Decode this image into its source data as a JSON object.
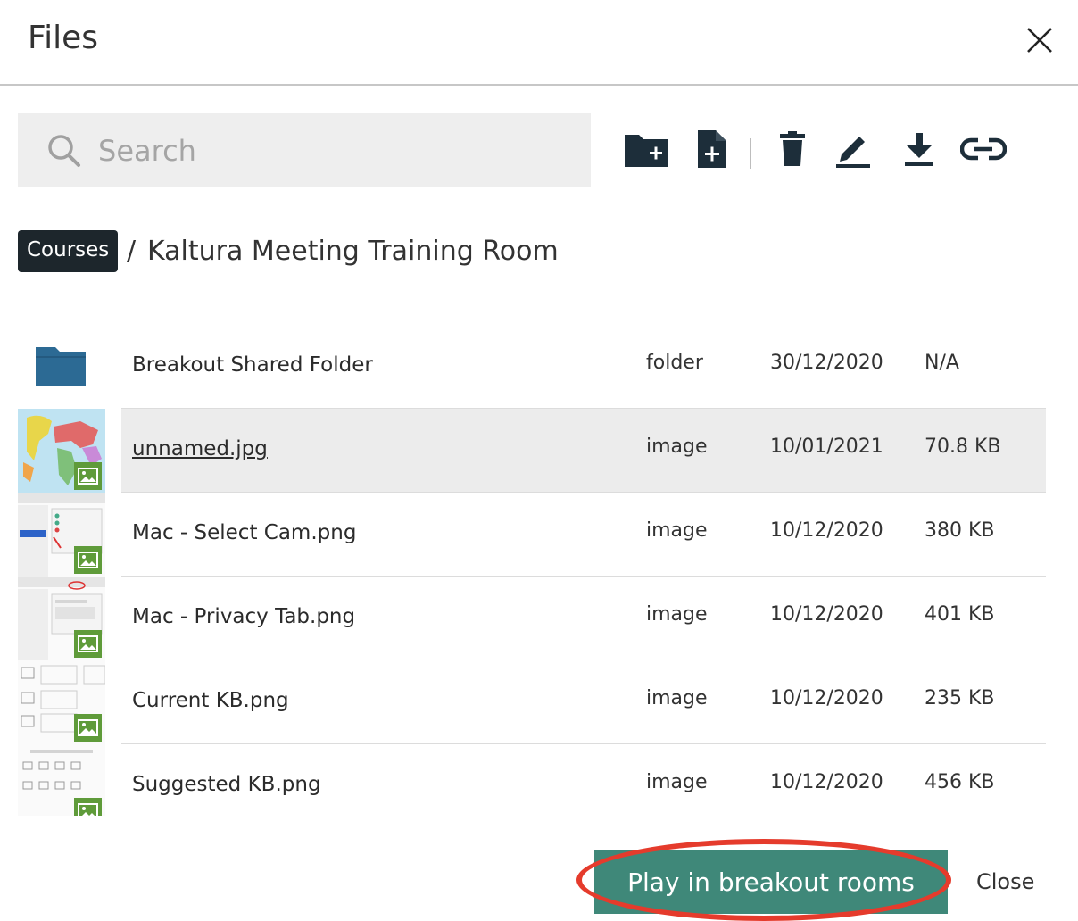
{
  "dialog": {
    "title": "Files"
  },
  "search": {
    "placeholder": "Search",
    "value": ""
  },
  "toolbar": {
    "icons": [
      "new-folder-icon",
      "new-file-icon",
      "delete-icon",
      "rename-icon",
      "download-icon",
      "link-icon"
    ]
  },
  "breadcrumb": {
    "root": "Courses",
    "separator": "/",
    "current": "Kaltura Meeting Training Room"
  },
  "files": [
    {
      "name": "Breakout Shared Folder",
      "type": "folder",
      "date": "30/12/2020",
      "size": "N/A",
      "icon": "folder-icon"
    },
    {
      "name": "unnamed.jpg",
      "type": "image",
      "date": "10/01/2021",
      "size": "70.8 KB",
      "icon": "image-thumbnail",
      "selected": true
    },
    {
      "name": "Mac - Select Cam.png",
      "type": "image",
      "date": "10/12/2020",
      "size": "380 KB",
      "icon": "image-thumbnail"
    },
    {
      "name": "Mac - Privacy Tab.png",
      "type": "image",
      "date": "10/12/2020",
      "size": "401 KB",
      "icon": "image-thumbnail"
    },
    {
      "name": "Current KB.png",
      "type": "image",
      "date": "10/12/2020",
      "size": "235 KB",
      "icon": "image-thumbnail"
    },
    {
      "name": "Suggested KB.png",
      "type": "image",
      "date": "10/12/2020",
      "size": "456 KB",
      "icon": "image-thumbnail"
    }
  ],
  "footer": {
    "primary_label": "Play in breakout rooms",
    "close_label": "Close"
  },
  "colors": {
    "primary": "#3f8879",
    "highlight": "#e53b2c",
    "badge": "#1d262c",
    "folder": "#2c6a94",
    "image_badge": "#5f9b3a"
  }
}
